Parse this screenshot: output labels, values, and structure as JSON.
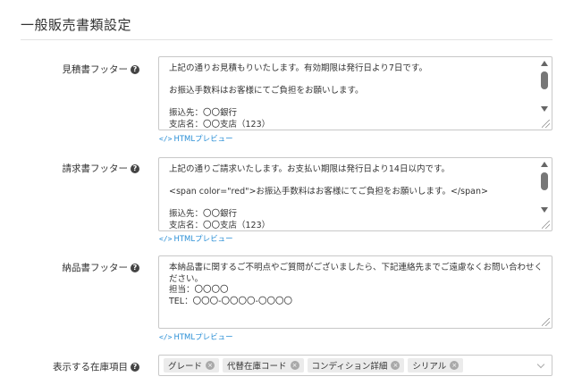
{
  "section": {
    "title": "一般販売書類設定"
  },
  "fields": [
    {
      "label": "見積書フッター",
      "text": "上記の通りお見積もりいたします。有効期限は発行日より7日です。\n\nお振込手数料はお客様にてご負担をお願いします。\n\n振込先：〇〇銀行\n支店名：〇〇支店（123）",
      "preview_label": "HTMLプレビュー",
      "preview_icon": "</>",
      "has_scrollbar": true
    },
    {
      "label": "請求書フッター",
      "text": "上記の通りご請求いたします。お支払い期限は発行日より14日以内です。\n\n<span color=\"red\">お振込手数料はお客様にてご負担をお願いします。</span>\n\n振込先：〇〇銀行\n支店名：〇〇支店（123）",
      "preview_label": "HTMLプレビュー",
      "preview_icon": "</>",
      "has_scrollbar": true
    },
    {
      "label": "納品書フッター",
      "text": "本納品書に関するご不明点やご質問がございましたら、下記連絡先までご遠慮なくお問い合わせください。\n担当：〇〇〇〇\nTEL：〇〇〇-〇〇〇〇-〇〇〇〇",
      "preview_label": "HTMLプレビュー",
      "preview_icon": "</>",
      "has_scrollbar": false
    }
  ],
  "inventory": {
    "label": "表示する在庫項目",
    "tags": [
      "グレード",
      "代替在庫コード",
      "コンディション詳細",
      "シリアル"
    ]
  },
  "help_icon_glyph": "?",
  "tag_close_glyph": "×"
}
